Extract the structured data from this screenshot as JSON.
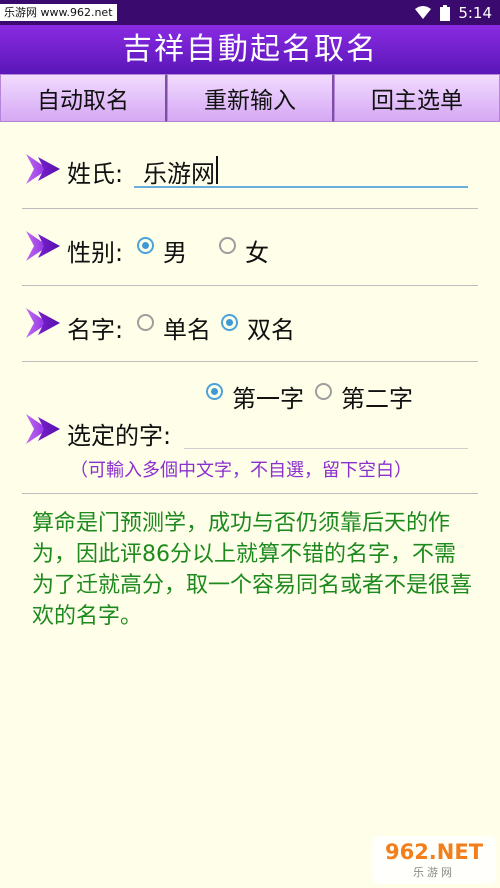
{
  "status": {
    "left_text": "乐游网 www.962.net",
    "time": "5:14"
  },
  "app_title": "吉祥自動起名取名",
  "nav": {
    "auto": "自动取名",
    "reset": "重新输入",
    "menu": "回主选单"
  },
  "surname": {
    "label": "姓氏:",
    "value": "乐游网"
  },
  "gender": {
    "label": "性别:",
    "options": [
      "男",
      "女"
    ],
    "selected": "男"
  },
  "name_length": {
    "label": "名字:",
    "options": [
      "单名",
      "双名"
    ],
    "selected": "双名"
  },
  "position": {
    "options": [
      "第一字",
      "第二字"
    ],
    "selected": "第一字"
  },
  "chosen_char": {
    "label": "选定的字:",
    "value": ""
  },
  "hint": "（可輸入多個中文字，不自選，留下空白）",
  "info_text": "算命是门预测学，成功与否仍须靠后天的作为，因此评86分以上就算不错的名字，不需为了迁就高分，取一个容易同名或者不是很喜欢的名字。",
  "watermark": {
    "top": "962.NET",
    "bottom": "乐游网"
  },
  "colors": {
    "title_bg": "#5a16b8",
    "accent_purple": "#8b2fcf",
    "radio_on": "#3d9ad6",
    "info_green": "#1d8a1d"
  }
}
